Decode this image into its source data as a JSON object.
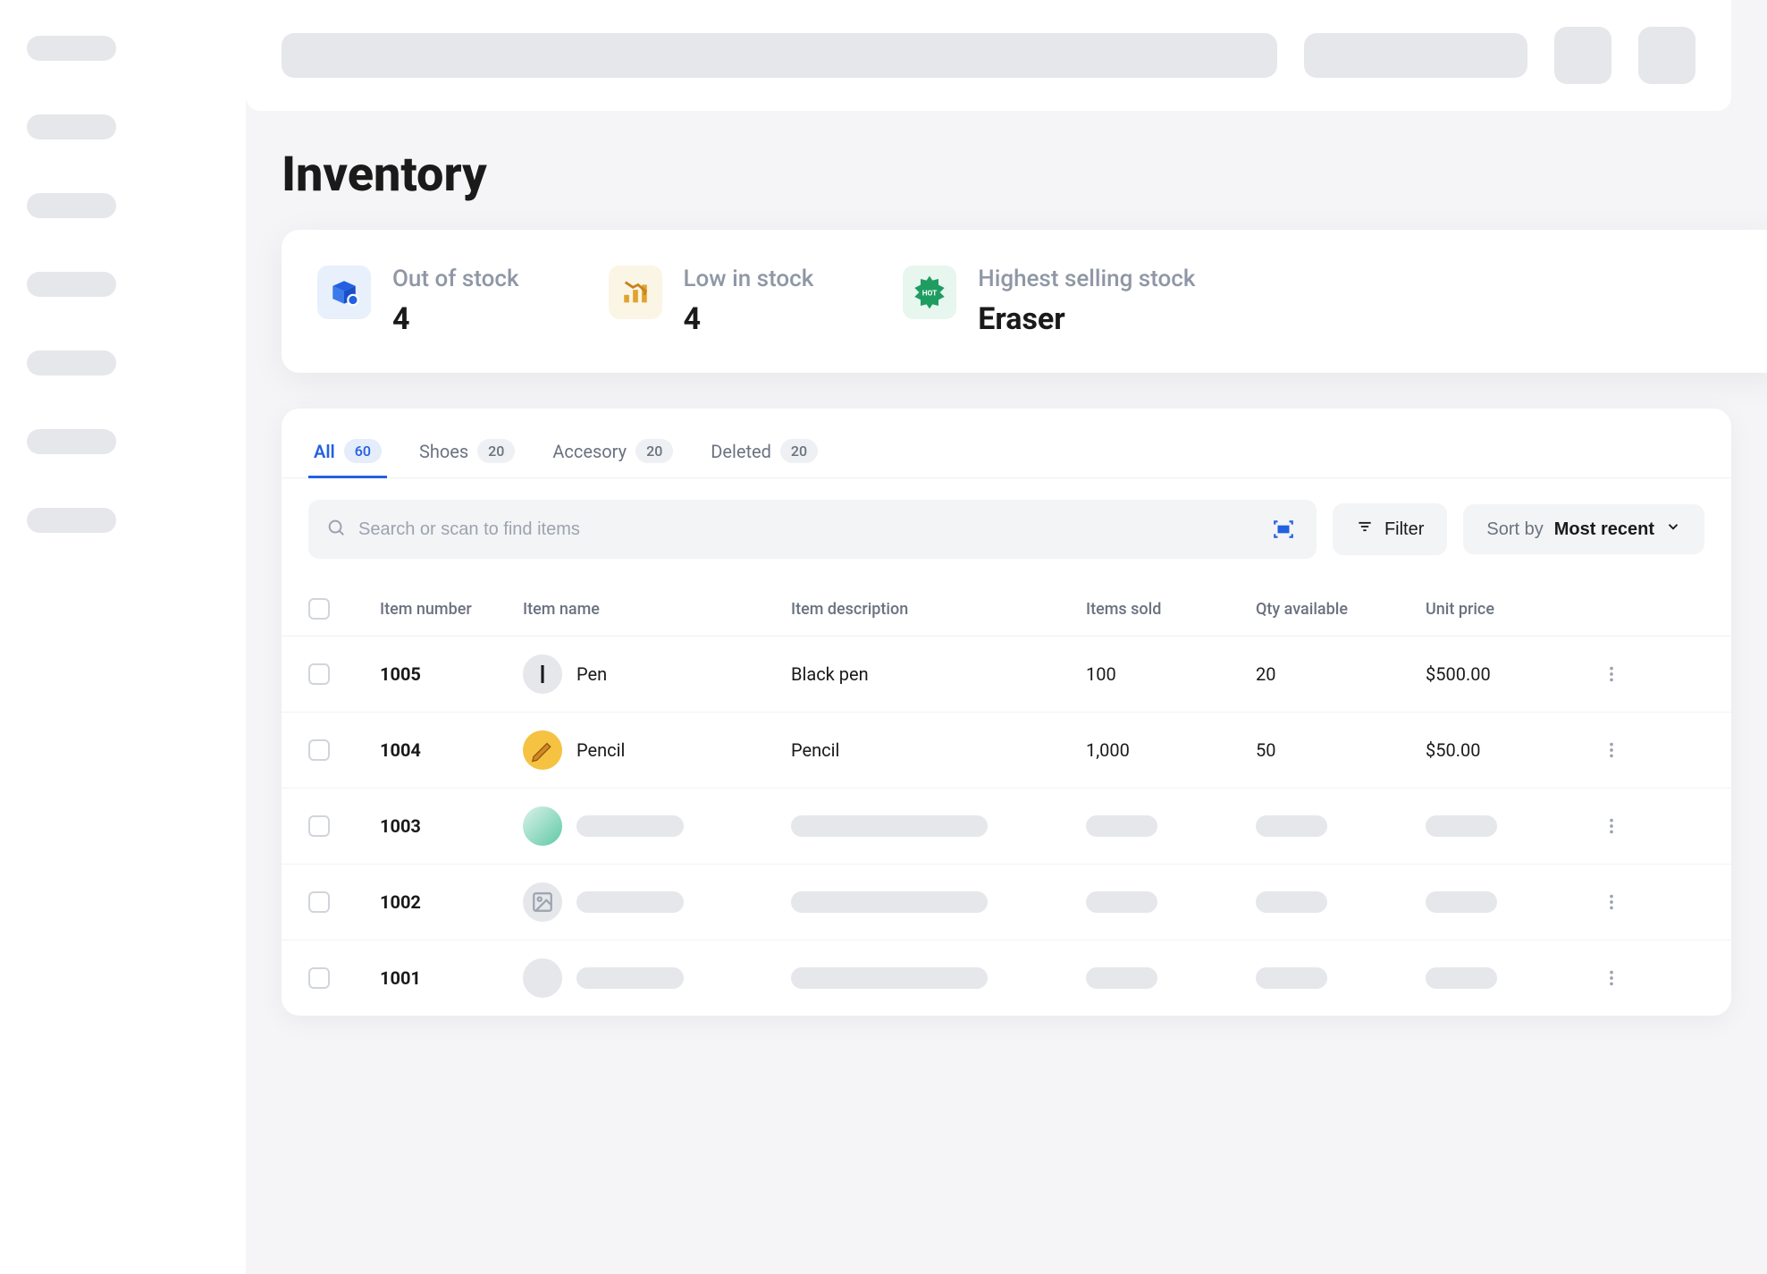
{
  "page": {
    "title": "Inventory"
  },
  "stats": {
    "out_of_stock": {
      "label": "Out of stock",
      "value": "4"
    },
    "low_in_stock": {
      "label": "Low in stock",
      "value": "4"
    },
    "highest_selling": {
      "label": "Highest selling stock",
      "value": "Eraser"
    }
  },
  "tabs": [
    {
      "label": "All",
      "count": "60",
      "active": true
    },
    {
      "label": "Shoes",
      "count": "20",
      "active": false
    },
    {
      "label": "Accesory",
      "count": "20",
      "active": false
    },
    {
      "label": "Deleted",
      "count": "20",
      "active": false
    }
  ],
  "toolbar": {
    "search_placeholder": "Search or scan to find items",
    "filter_label": "Filter",
    "sort_label": "Sort by",
    "sort_value": "Most recent"
  },
  "columns": {
    "item_number": "Item number",
    "item_name": "Item name",
    "item_description": "Item description",
    "items_sold": "Items sold",
    "qty_available": "Qty available",
    "unit_price": "Unit price"
  },
  "rows": [
    {
      "number": "1005",
      "name": "Pen",
      "description": "Black pen",
      "sold": "100",
      "qty": "20",
      "price": "$500.00",
      "img": "pen",
      "loaded": true
    },
    {
      "number": "1004",
      "name": "Pencil",
      "description": "Pencil",
      "sold": "1,000",
      "qty": "50",
      "price": "$50.00",
      "img": "pencil",
      "loaded": true
    },
    {
      "number": "1003",
      "name": "",
      "description": "",
      "sold": "",
      "qty": "",
      "price": "",
      "img": "teal",
      "loaded": false
    },
    {
      "number": "1002",
      "name": "",
      "description": "",
      "sold": "",
      "qty": "",
      "price": "",
      "img": "placeholder",
      "loaded": false
    },
    {
      "number": "1001",
      "name": "",
      "description": "",
      "sold": "",
      "qty": "",
      "price": "",
      "img": "gray",
      "loaded": false
    }
  ]
}
